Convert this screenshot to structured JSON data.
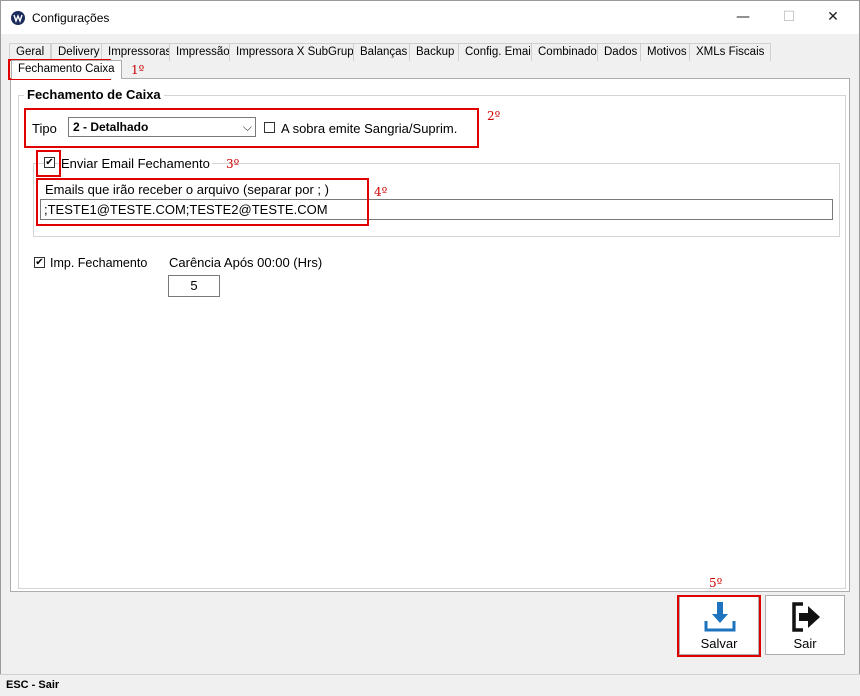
{
  "window": {
    "title": "Configurações",
    "minimize": "—",
    "maximize": "☐",
    "close": "✕"
  },
  "tabs": [
    "Geral",
    "Delivery",
    "Impressoras",
    "Impressão",
    "Impressora X SubGrupo",
    "Balanças",
    "Backup",
    "Config. Email",
    "Combinado",
    "Dados",
    "Motivos",
    "XMLs Fiscais"
  ],
  "active_tab": "Fechamento Caixa",
  "group": {
    "title": "Fechamento de Caixa",
    "tipo_label": "Tipo",
    "tipo_value": "2 - Detalhado",
    "sobra_label": "A sobra emite Sangria/Suprim.",
    "sobra_checked": false,
    "enviar_email_label": "Enviar Email Fechamento",
    "enviar_email_checked": true,
    "emails_label": "Emails que irão receber o arquivo (separar por ; )",
    "emails_value": ";TESTE1@TESTE.COM;TESTE2@TESTE.COM",
    "imp_fechamento_label": "Imp. Fechamento",
    "imp_fechamento_checked": true,
    "carencia_label": "Carência Após 00:00 (Hrs)",
    "carencia_value": "5"
  },
  "buttons": {
    "salvar": "Salvar",
    "sair": "Sair"
  },
  "annotations": [
    "1º",
    "2º",
    "3º",
    "4º",
    "5º"
  ],
  "statusbar": {
    "text": "ESC - Sair"
  },
  "colors": {
    "annotation_red": "#e00000",
    "accent_blue": "#1e73be"
  }
}
